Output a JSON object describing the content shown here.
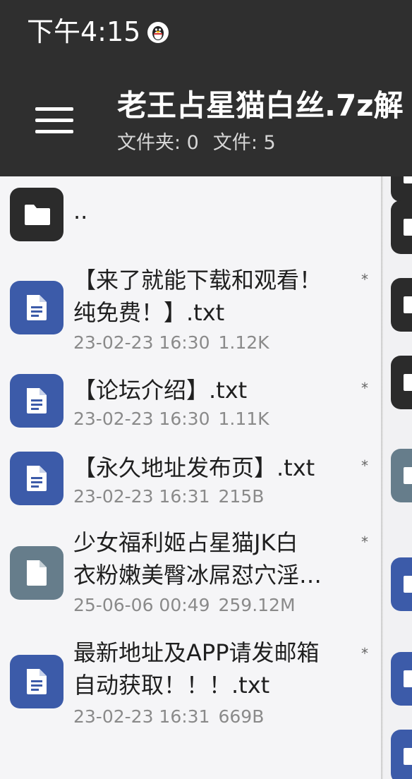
{
  "status_bar": {
    "time": "下午4:15",
    "notification_icon": "qq-penguin-icon"
  },
  "appbar": {
    "menu_icon": "hamburger-menu-icon",
    "title": "老王占星猫白丝.7z解",
    "subtitle_folders": "文件夹: 0",
    "subtitle_files": "文件: 5"
  },
  "files": [
    {
      "name": "..",
      "icon": "folder-icon"
    },
    {
      "name_line1": "【来了就能下载和观看！",
      "name_line2": "纯免费！】.txt",
      "date": "23-02-23 16:30",
      "size": "1.12K",
      "flag": "*",
      "icon": "text-file-icon"
    },
    {
      "name": "【论坛介绍】.txt",
      "date": "23-02-23 16:30",
      "size": "1.11K",
      "flag": "*",
      "icon": "text-file-icon"
    },
    {
      "name": "【永久地址发布页】.txt",
      "date": "23-02-23 16:31",
      "size": "215B",
      "flag": "*",
      "icon": "text-file-icon"
    },
    {
      "name_line1": "少女福利姬占星猫JK白",
      "name_line2": "衣粉嫩美臀冰屌怼穴淫…",
      "date": "25-06-06 00:49",
      "size": "259.12M",
      "flag": "*",
      "icon": "generic-file-icon"
    },
    {
      "name_line1": "最新地址及APP请发邮箱",
      "name_line2": "自动获取！！！.txt",
      "date": "23-02-23 16:31",
      "size": "669B",
      "flag": "*",
      "icon": "text-file-icon"
    }
  ],
  "colors": {
    "appbar_bg": "#2f2f2f",
    "list_bg": "#f5f5f7",
    "text_icon_bg": "#3c5ba9",
    "generic_icon_bg": "#667d8b",
    "folder_icon_bg": "#2b2b2b"
  }
}
